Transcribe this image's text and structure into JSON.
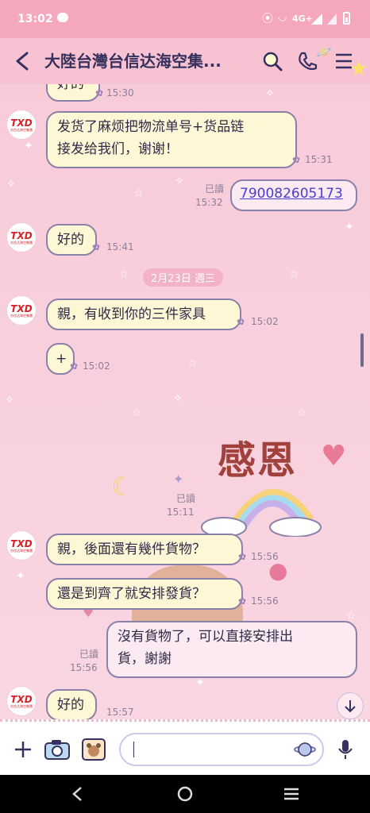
{
  "status_bar": {
    "time": "13:02",
    "network": "4G+"
  },
  "header": {
    "title": "大陸台灣台信达海空集..."
  },
  "avatar_text": {
    "main": "TXD",
    "sub": "台信达海空集團"
  },
  "messages": [
    {
      "text": "好的",
      "time": "15:30"
    },
    {
      "text_line1": "发货了麻烦把物流单号+货品链",
      "text_line2": "接发给我们，谢谢！",
      "time": "15:31"
    },
    {
      "text": "790082605173",
      "read": "已讀",
      "time": "15:32"
    },
    {
      "text": "好的",
      "time": "15:41"
    },
    {
      "text": "親，有收到你的三件家具",
      "time": "15:02"
    },
    {
      "text": "+",
      "time": "15:02"
    },
    {
      "read": "已讀",
      "time": "15:11"
    },
    {
      "text": "親，後面還有幾件貨物？",
      "time": "15:56"
    },
    {
      "text": "還是到齊了就安排發貨？",
      "time": "15:56"
    },
    {
      "text_line1": "沒有貨物了，可以直接安排出",
      "text_line2": "貨，謝謝",
      "read": "已讀",
      "time": "15:56"
    },
    {
      "text": "好的",
      "time": "15:57"
    }
  ],
  "date_divider": "2月23日 週三",
  "sticker": {
    "text": "感恩"
  },
  "colors": {
    "header_bg": "#f7c3d2",
    "status_bg": "#f4a7bd",
    "bubble_bg": "#fdf7d5",
    "bubble_border": "#8a81a8",
    "link": "#4a3ed0"
  },
  "icons": [
    "back-icon",
    "search-icon",
    "phone-icon",
    "menu-icon",
    "plus-icon",
    "camera-icon",
    "gallery-icon",
    "emoji-icon",
    "mic-icon",
    "scroll-down-icon",
    "nav-back-icon",
    "nav-home-icon",
    "nav-recents-icon"
  ]
}
